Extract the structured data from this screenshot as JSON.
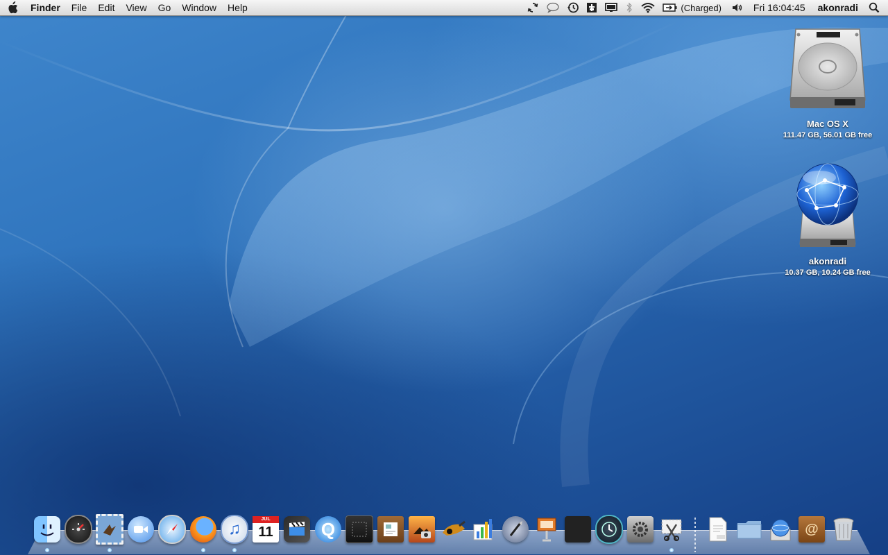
{
  "menubar": {
    "apple_icon": "apple-icon",
    "app_name": "Finder",
    "menus": [
      "File",
      "Edit",
      "View",
      "Go",
      "Window",
      "Help"
    ],
    "status_icons": [
      "sync-icon",
      "ichat-status-icon",
      "time-machine-icon",
      "script-menu-icon",
      "display-mirror-icon",
      "bluetooth-icon",
      "wifi-icon",
      "battery-icon"
    ],
    "battery_text": "(Charged)",
    "volume_icon": "volume-icon",
    "clock": "Fri 16:04:45",
    "user": "akonradi",
    "spotlight_icon": "spotlight-icon"
  },
  "desktop": {
    "icons": [
      {
        "label": "Mac OS X",
        "info": "111.47 GB, 56.01 GB free",
        "icon": "hard-drive-icon"
      },
      {
        "label": "akonradi",
        "info": "10.37 GB, 10.24 GB free",
        "icon": "network-volume-icon"
      }
    ]
  },
  "dock": {
    "apps": [
      "finder",
      "dashboard",
      "mail",
      "ichat",
      "safari",
      "firefox",
      "itunes",
      "ical",
      "imovie",
      "quicktime",
      "dvd-player",
      "iweb",
      "iphoto",
      "garageband",
      "numbers",
      "script-editor",
      "keynote",
      "spaces",
      "time-machine",
      "system-preferences",
      "grab",
      "pdf-document",
      "folder",
      "network-folder",
      "address-book",
      "trash"
    ],
    "ical_date": "11",
    "ical_month": "JUL",
    "running": [
      "finder",
      "mail",
      "firefox",
      "itunes",
      "grab"
    ]
  },
  "colors": {
    "menubar_top": "#f6f6f6",
    "menubar_bottom": "#d9d9d9",
    "wallpaper": "#2f74bd",
    "running_indicator": "#9fd8ff"
  }
}
